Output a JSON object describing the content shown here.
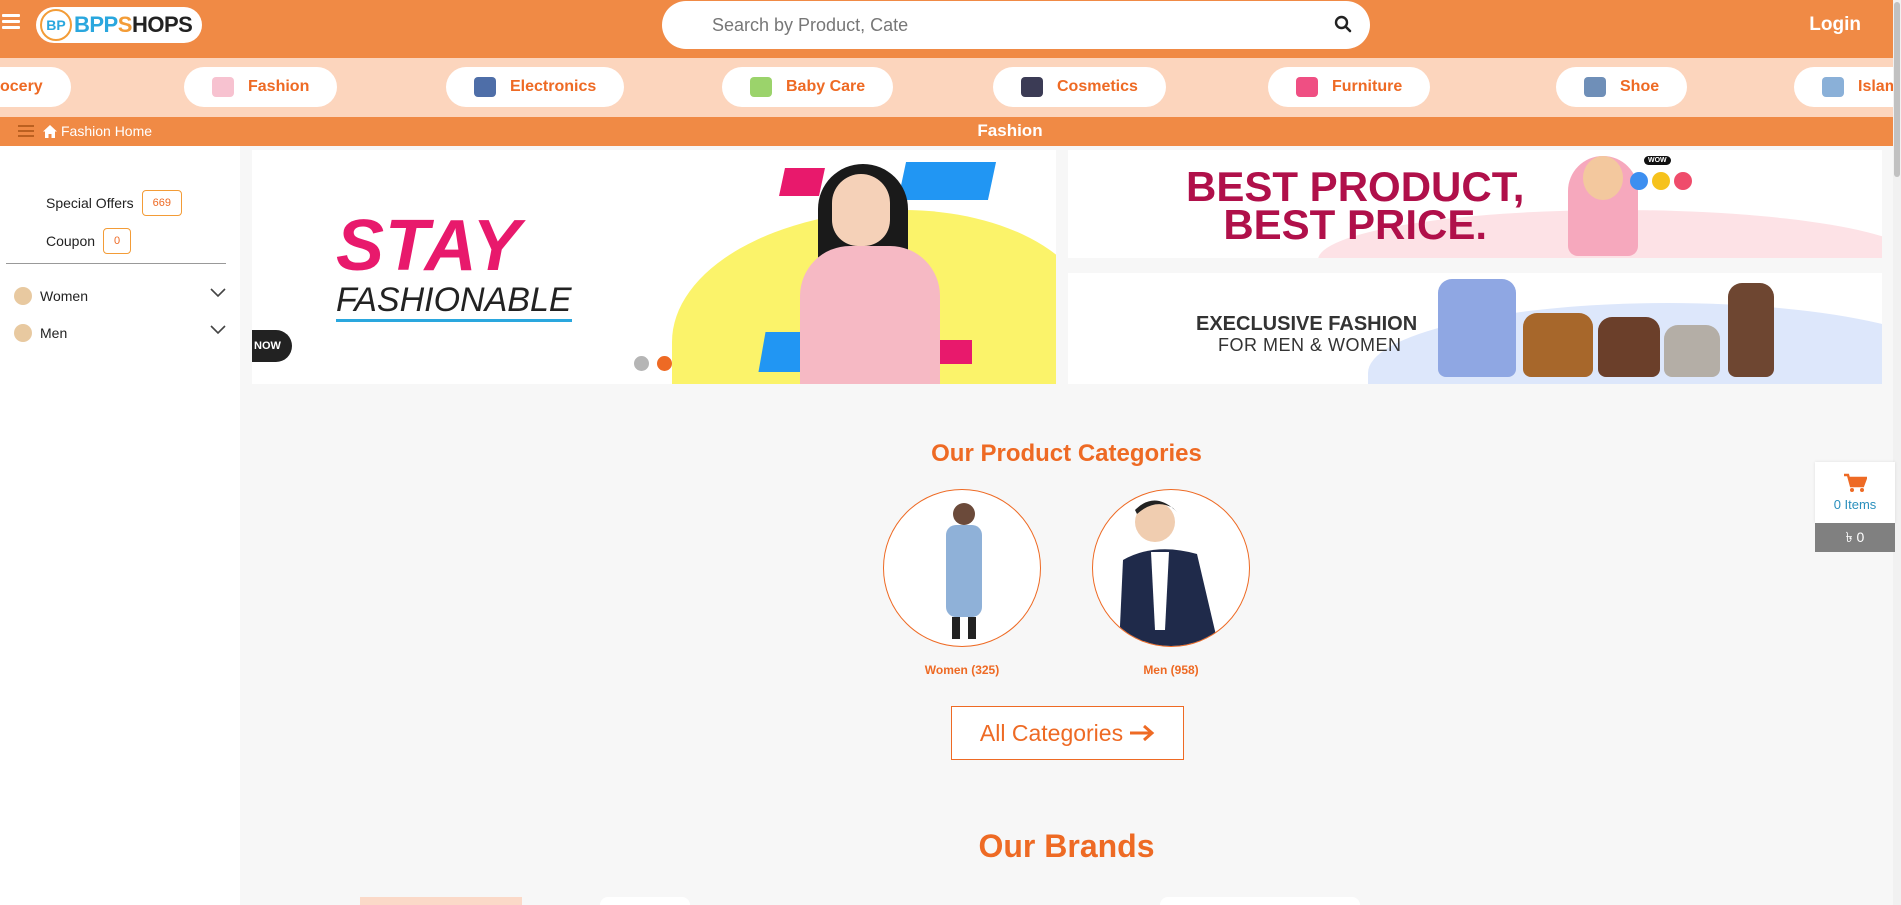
{
  "header": {
    "logo_mark": "BP",
    "logo_b": "BPP",
    "logo_s": "S",
    "logo_k": "HOPS",
    "search_placeholder": "Search by Product, Cate",
    "login_label": "Login"
  },
  "category_strip": [
    {
      "label": "ocery",
      "icon": "grocery-icon"
    },
    {
      "label": "Fashion",
      "icon": "fashion-icon"
    },
    {
      "label": "Electronics",
      "icon": "electronics-icon"
    },
    {
      "label": "Baby Care",
      "icon": "baby-care-icon"
    },
    {
      "label": "Cosmetics",
      "icon": "cosmetics-icon"
    },
    {
      "label": "Furniture",
      "icon": "furniture-icon"
    },
    {
      "label": "Shoe",
      "icon": "shoe-icon"
    },
    {
      "label": "Islam",
      "icon": "islamic-icon"
    }
  ],
  "subbar": {
    "home_label": "Fashion Home",
    "page_title": "Fashion"
  },
  "sidebar": {
    "special_offers_label": "Special Offers",
    "special_offers_count": "669",
    "coupon_label": "Coupon",
    "coupon_count": "0",
    "categories": [
      {
        "label": "Women"
      },
      {
        "label": "Men"
      }
    ]
  },
  "banners": {
    "main_title": "STAY",
    "main_subtitle": "FASHIONABLE",
    "main_button": "NOW",
    "right1_line1": "BEST PRODUCT,",
    "right1_line2": "BEST PRICE.",
    "right1_badge": "WOW",
    "right2_line1": "EXECLUSIVE FASHION",
    "right2_line2": "FOR MEN & WOMEN",
    "slider_dots": 2,
    "active_dot": 2
  },
  "categories_section": {
    "title": "Our Product Categories",
    "items": [
      {
        "label": "Women (325)"
      },
      {
        "label": "Men (958)"
      }
    ],
    "all_button": "All Categories"
  },
  "brands_section": {
    "title": "Our Brands"
  },
  "cart": {
    "items_label": "0 Items",
    "total_label": "৳ 0"
  },
  "colors": {
    "primary": "#f08a45",
    "accent": "#ee6a24",
    "strip_bg": "#fcd5bd"
  }
}
